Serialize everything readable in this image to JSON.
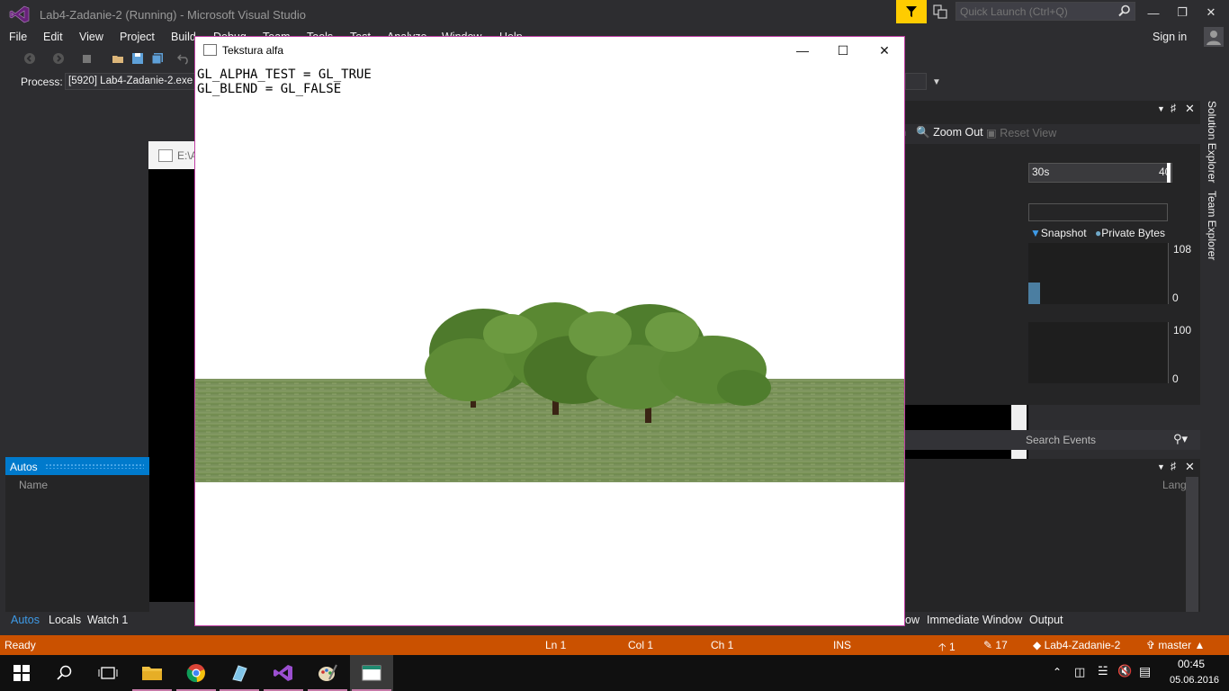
{
  "vs": {
    "title": "Lab4-Zadanie-2 (Running) - Microsoft Visual Studio",
    "quick_launch_placeholder": "Quick Launch (Ctrl+Q)",
    "menu": [
      "File",
      "Edit",
      "View",
      "Project",
      "Build",
      "Debug",
      "Team",
      "Tools",
      "Test",
      "Analyze",
      "Window",
      "Help"
    ],
    "sign_in": "Sign in",
    "process_label": "Process:",
    "process_value": "[5920] Lab4-Zadanie-2.exe"
  },
  "console_window": {
    "title": "E:\\A"
  },
  "diagnostics": {
    "zoom_out": "Zoom Out",
    "reset_view": "Reset View",
    "timeline_start": "30s",
    "timeline_end": "40",
    "legend_snapshot": "Snapshot",
    "legend_private_bytes": "Private Bytes",
    "gc_max": "108",
    "gc_min": "0",
    "mem_max": "100",
    "mem_min": "0",
    "search_events_placeholder": "Search Events",
    "lang_column": "Lang"
  },
  "side_tabs": [
    "Solution Explorer",
    "Team Explorer"
  ],
  "autos": {
    "title": "Autos",
    "name_column": "Name",
    "bottom_tabs": [
      "Autos",
      "Locals",
      "Watch 1"
    ]
  },
  "bottom_right_tabs": [
    "ow",
    "Immediate Window",
    "Output"
  ],
  "statusbar": {
    "ready": "Ready",
    "ln": "Ln 1",
    "col": "Col 1",
    "ch": "Ch 1",
    "ins": "INS",
    "up_count": "1",
    "edit_count": "17",
    "repo": "Lab4-Zadanie-2",
    "branch": "master"
  },
  "taskbar": {
    "time": "00:45",
    "date": "05.06.2016",
    "apps": [
      "file-explorer-icon",
      "chrome-icon",
      "app-icon",
      "visual-studio-icon",
      "paint-icon",
      "gl-app-icon"
    ]
  },
  "gl_window": {
    "title": "Tekstura alfa",
    "line1": "GL_ALPHA_TEST = GL_TRUE",
    "line2": "GL_BLEND = GL_FALSE"
  },
  "colors": {
    "status_bar": "#ca5100",
    "accent": "#007acc",
    "filter_yellow": "#ffcc00",
    "gl_border": "#c13fa5"
  }
}
